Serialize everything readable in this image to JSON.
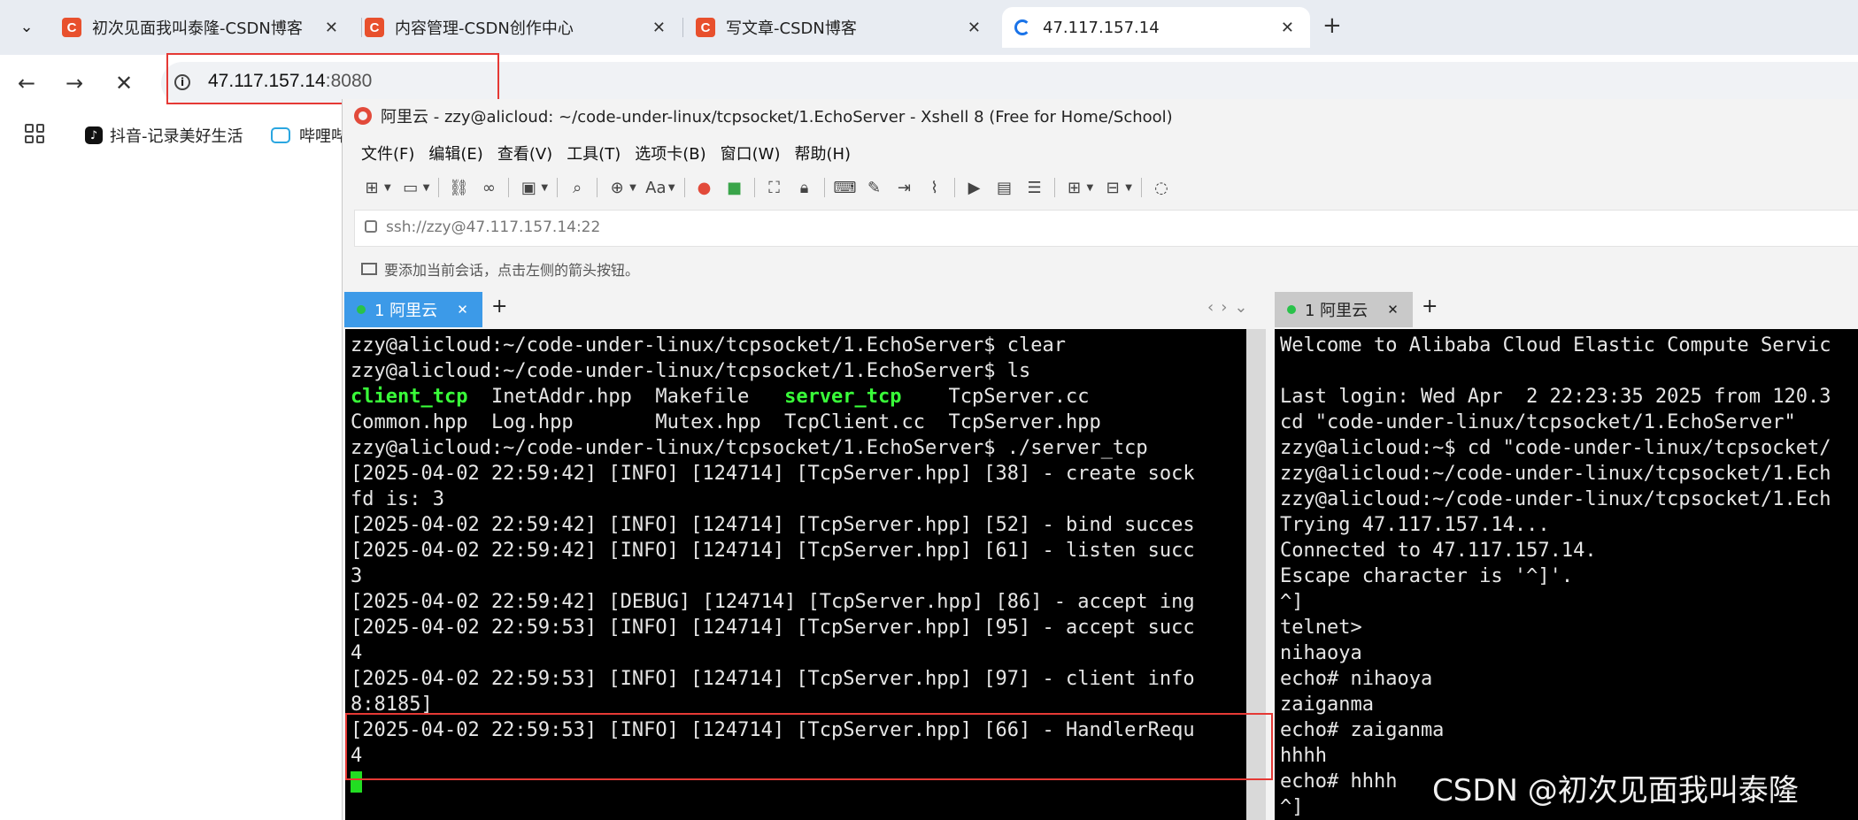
{
  "browser": {
    "tabs": [
      {
        "title": "初次见面我叫泰隆-CSDN博客",
        "favicon": "C"
      },
      {
        "title": "内容管理-CSDN创作中心",
        "favicon": "C"
      },
      {
        "title": "写文章-CSDN博客",
        "favicon": "C"
      },
      {
        "title": "47.117.157.14",
        "favicon": ""
      }
    ],
    "new_tab": "+",
    "close_glyph": "✕",
    "address": {
      "host": "47.117.157.14",
      "port": ":8080"
    },
    "bookmarks": [
      {
        "label": "抖音-记录美好生活"
      },
      {
        "label": "哔哩哔"
      }
    ]
  },
  "xshell": {
    "title": "阿里云 - zzy@alicloud: ~/code-under-linux/tcpsocket/1.EchoServer - Xshell 8 (Free for Home/School)",
    "menu": [
      "文件(F)",
      "编辑(E)",
      "查看(V)",
      "工具(T)",
      "选项卡(B)",
      "窗口(W)",
      "帮助(H)"
    ],
    "ssh_address": "ssh://zzy@47.117.157.14:22",
    "hint": "要添加当前会话，点击左侧的箭头按钮。",
    "session_tabs": [
      {
        "label": "1 阿里云",
        "active": true
      },
      {
        "label": "1 阿里云",
        "active": false
      }
    ],
    "accent_color": "#3c9ae8"
  },
  "terminal_left": {
    "lines": [
      [
        {
          "t": "zzy@alicloud:~/code-under-linux/tcpsocket/1.EchoServer$ clear"
        }
      ],
      [
        {
          "t": "zzy@alicloud:~/code-under-linux/tcpsocket/1.EchoServer$ ls"
        }
      ],
      [
        {
          "t": "client_tcp",
          "g": true
        },
        {
          "t": "  InetAddr.hpp  Makefile   "
        },
        {
          "t": "server_tcp",
          "g": true
        },
        {
          "t": "    TcpServer.cc"
        }
      ],
      [
        {
          "t": "Common.hpp  Log.hpp       Mutex.hpp  TcpClient.cc  TcpServer.hpp"
        }
      ],
      [
        {
          "t": "zzy@alicloud:~/code-under-linux/tcpsocket/1.EchoServer$ ./server_tcp"
        }
      ],
      [
        {
          "t": "[2025-04-02 22:59:42] [INFO] [124714] [TcpServer.hpp] [38] - create sock"
        }
      ],
      [
        {
          "t": "fd is: 3"
        }
      ],
      [
        {
          "t": "[2025-04-02 22:59:42] [INFO] [124714] [TcpServer.hpp] [52] - bind succes"
        }
      ],
      [
        {
          "t": "[2025-04-02 22:59:42] [INFO] [124714] [TcpServer.hpp] [61] - listen succ"
        }
      ],
      [
        {
          "t": "3"
        }
      ],
      [
        {
          "t": "[2025-04-02 22:59:42] [DEBUG] [124714] [TcpServer.hpp] [86] - accept ing"
        }
      ],
      [
        {
          "t": "[2025-04-02 22:59:53] [INFO] [124714] [TcpServer.hpp] [95] - accept succ"
        }
      ],
      [
        {
          "t": "4"
        }
      ],
      [
        {
          "t": "[2025-04-02 22:59:53] [INFO] [124714] [TcpServer.hpp] [97] - client info"
        }
      ],
      [
        {
          "t": "8:8185]"
        }
      ],
      [
        {
          "t": "[2025-04-02 22:59:53] [INFO] [124714] [TcpServer.hpp] [66] - HandlerRequ"
        }
      ],
      [
        {
          "t": "4"
        }
      ]
    ]
  },
  "terminal_right": {
    "lines": [
      "Welcome to Alibaba Cloud Elastic Compute Servic",
      "",
      "Last login: Wed Apr  2 22:23:35 2025 from 120.3",
      "cd \"code-under-linux/tcpsocket/1.EchoServer\"",
      "zzy@alicloud:~$ cd \"code-under-linux/tcpsocket/",
      "zzy@alicloud:~/code-under-linux/tcpsocket/1.Ech",
      "zzy@alicloud:~/code-under-linux/tcpsocket/1.Ech",
      "Trying 47.117.157.14...",
      "Connected to 47.117.157.14.",
      "Escape character is '^]'.",
      "^]",
      "telnet>",
      "nihaoya",
      "echo# nihaoya",
      "zaiganma",
      "echo# zaiganma",
      "hhhh",
      "echo# hhhh",
      "^]"
    ]
  },
  "watermark": "CSDN @初次见面我叫泰隆"
}
